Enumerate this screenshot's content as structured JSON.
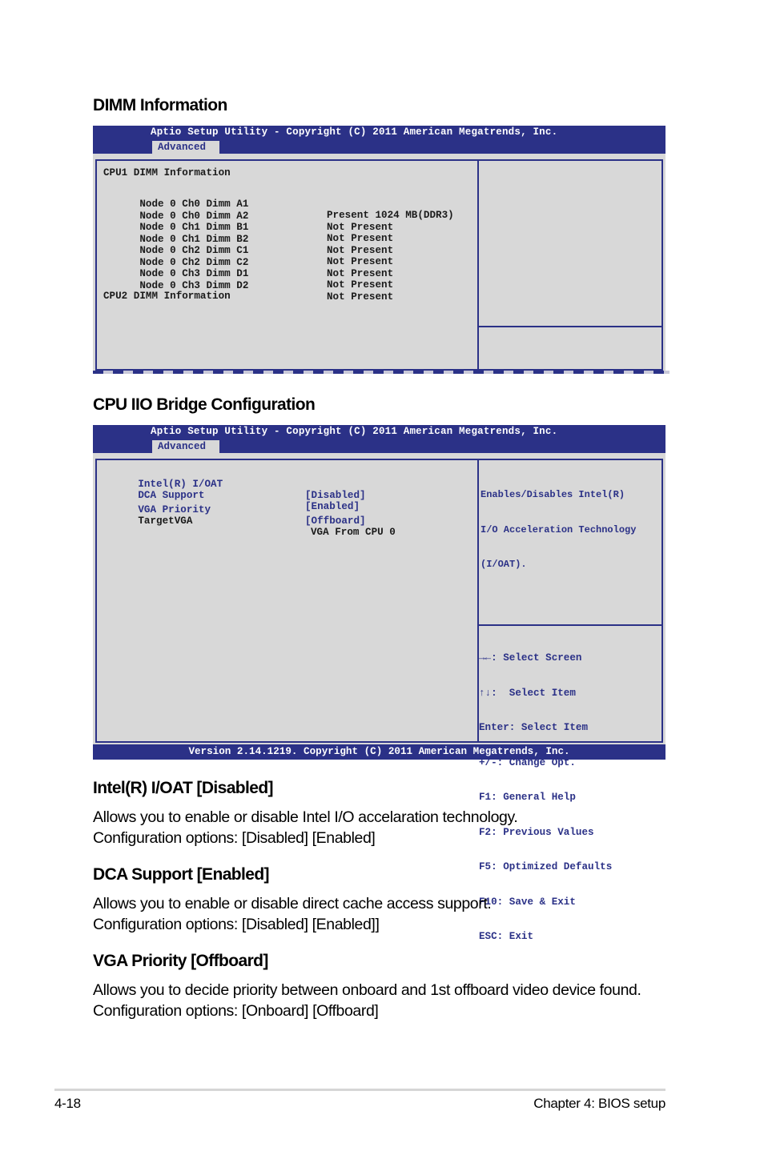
{
  "sections": {
    "dimm_title": "DIMM Information",
    "cpu_iio_title": "CPU IIO Bridge Configuration"
  },
  "bios1": {
    "title": "Aptio Setup Utility - Copyright (C) 2011 American Megatrends, Inc.",
    "tab": "Advanced",
    "cpu1_heading": "CPU1 DIMM Information",
    "rows": [
      {
        "label": "Node 0 Ch0 Dimm A1",
        "value": "Present 1024 MB(DDR3)"
      },
      {
        "label": "Node 0 Ch0 Dimm A2",
        "value": "Not Present"
      },
      {
        "label": "Node 0 Ch1 Dimm B1",
        "value": "Not Present"
      },
      {
        "label": "Node 0 Ch1 Dimm B2",
        "value": "Not Present"
      },
      {
        "label": "Node 0 Ch2 Dimm C1",
        "value": "Not Present"
      },
      {
        "label": "Node 0 Ch2 Dimm C2",
        "value": "Not Present"
      },
      {
        "label": "Node 0 Ch3 Dimm D1",
        "value": "Not Present"
      },
      {
        "label": "Node 0 Ch3 Dimm D2",
        "value": "Not Present"
      }
    ],
    "cpu2_heading": "CPU2 DIMM Information"
  },
  "bios2": {
    "title": "Aptio Setup Utility - Copyright (C) 2011 American Megatrends, Inc.",
    "tab": "Advanced",
    "items": [
      {
        "label": "Intel(R) I/OAT",
        "value": "[Disabled]"
      },
      {
        "label": "DCA Support",
        "value": "[Enabled]"
      },
      {
        "label": "VGA Priority",
        "value": "[Offboard]"
      }
    ],
    "target_vga": {
      "label": "TargetVGA",
      "value": "VGA From CPU 0"
    },
    "help_text": [
      "Enables/Disables Intel(R)",
      "I/O Acceleration Technology",
      "(I/OAT)."
    ],
    "keys": [
      "→←: Select Screen",
      "↑↓:  Select Item",
      "Enter: Select Item",
      "+/-: Change Opt.",
      "F1: General Help",
      "F2: Previous Values",
      "F5: Optimized Defaults",
      "F10: Save & Exit",
      "ESC: Exit"
    ],
    "footer": "Version 2.14.1219. Copyright (C) 2011 American Megatrends, Inc."
  },
  "descriptions": [
    {
      "heading": "Intel(R) I/OAT [Disabled]",
      "line1": "Allows you to enable or disable Intel I/O accelaration technology.",
      "line2": "Configuration options: [Disabled] [Enabled]"
    },
    {
      "heading": "DCA Support [Enabled]",
      "line1": "Allows you to enable or disable direct cache access support.",
      "line2": "Configuration options: [Disabled] [Enabled]]"
    },
    {
      "heading": "VGA Priority [Offboard]",
      "line1": "Allows you to decide priority between onboard and 1st offboard video device found.",
      "line2": "Configuration options: [Onboard] [Offboard]"
    }
  ],
  "page_footer": {
    "page_number": "4-18",
    "chapter": "Chapter 4: BIOS setup"
  }
}
